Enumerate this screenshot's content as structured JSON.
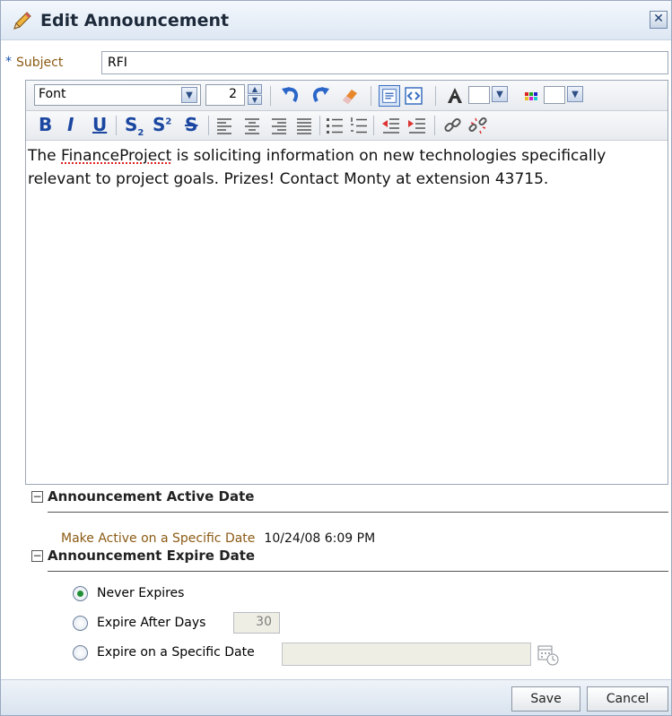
{
  "dialog": {
    "title": "Edit Announcement",
    "close_label": "✕",
    "icon": "pencil-icon"
  },
  "subject": {
    "required_marker": "*",
    "label": "Subject",
    "value": "RFI"
  },
  "toolbar": {
    "font_select": "Font",
    "font_size": "2",
    "icons_row1": [
      "undo-icon",
      "redo-icon",
      "eraser-icon",
      "rich-text-mode-icon",
      "source-mode-icon",
      "font-color-icon",
      "background-color-icon"
    ],
    "format_buttons": {
      "bold": "B",
      "italic": "I",
      "underline": "U",
      "subscript": "S",
      "superscript": "S",
      "strikethrough": "S"
    },
    "icons_row2": [
      "align-left-icon",
      "align-center-icon",
      "align-right-icon",
      "justify-icon",
      "bulleted-list-icon",
      "numbered-list-icon",
      "outdent-icon",
      "indent-icon",
      "link-icon",
      "unlink-icon"
    ]
  },
  "editor": {
    "text_before": "The ",
    "misspelled": "FinanceProject",
    "text_after": " is soliciting information on new technologies specifically relevant to project goals. Prizes! Contact Monty at extension 43715."
  },
  "active_section": {
    "title": "Announcement Active Date",
    "label": "Make Active on a Specific Date",
    "value": "10/24/08 6:09 PM"
  },
  "expire_section": {
    "title": "Announcement Expire Date",
    "options": [
      {
        "label": "Never Expires",
        "selected": true
      },
      {
        "label": "Expire After Days",
        "selected": false
      },
      {
        "label": "Expire on a Specific Date",
        "selected": false
      }
    ],
    "days_value": "30"
  },
  "footer": {
    "save_label": "Save",
    "cancel_label": "Cancel"
  },
  "colors": {
    "accent": "#1b47a1",
    "label_brown": "#8b5a13"
  }
}
